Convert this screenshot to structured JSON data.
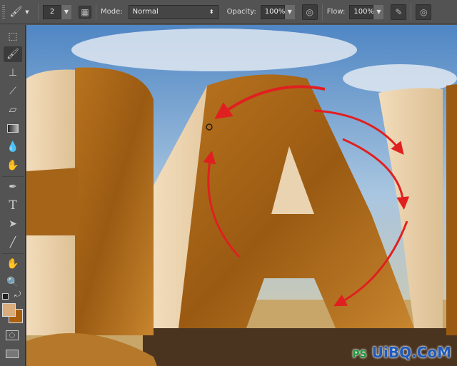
{
  "options_bar": {
    "brush_size": "2",
    "mode_label": "Mode:",
    "mode_value": "Normal",
    "opacity_label": "Opacity:",
    "opacity_value": "100%",
    "flow_label": "Flow:",
    "flow_value": "100%"
  },
  "tools": [
    "marquee",
    "brush",
    "clone-stamp",
    "history-brush",
    "eraser",
    "gradient",
    "blur",
    "smudge",
    "pen",
    "type",
    "path-selection",
    "line",
    "hand",
    "zoom"
  ],
  "colors": {
    "foreground": "#d9ad7c",
    "background": "#a8600f",
    "arrow": "#e02020"
  },
  "watermark": "UiBQ.CoM"
}
